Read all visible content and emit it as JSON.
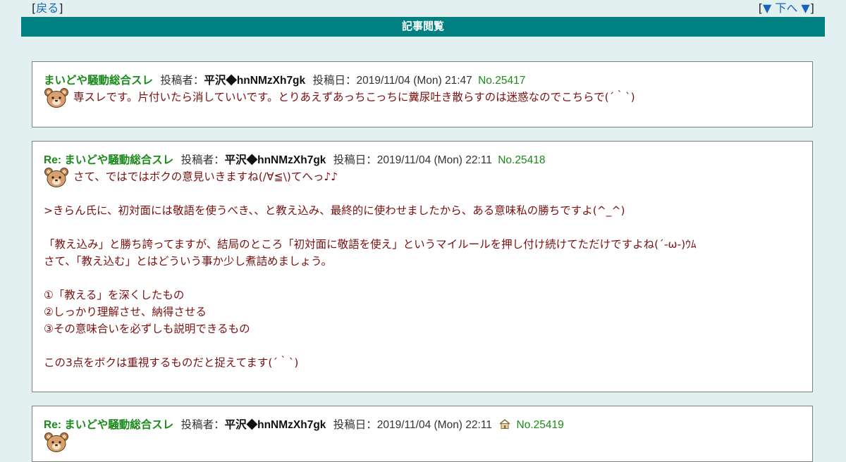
{
  "nav": {
    "back_label": "戻る",
    "down_label": "▼ 下へ ▼"
  },
  "title": "記事閲覧",
  "posts": [
    {
      "subject": "まいどや騒動総合スレ",
      "author_label": "投稿者：",
      "author": "平沢◆hnNMzXh7gk",
      "date_label": "投稿日：",
      "date": "2019/11/04 (Mon) 21:47",
      "no": "No.25417",
      "lines": [
        "専スレです。片付いたら消していいです。とりあえずあっちこっちに糞尿吐き散らすのは迷惑なのでこちらで(´｀`)"
      ]
    },
    {
      "subject": "Re: まいどや騒動総合スレ",
      "author_label": "投稿者：",
      "author": "平沢◆hnNMzXh7gk",
      "date_label": "投稿日：",
      "date": "2019/11/04 (Mon) 22:11",
      "no": "No.25418",
      "lines": [
        "さて、ではではボクの意見いきますね(/∀≦\\)てへっ♪♪",
        "",
        ">きらん氏に、初対面には敬語を使うべき、、と教え込み、最終的に使わせましたから、ある意味私の勝ちですよ(^_^)",
        "",
        "「教え込み」と勝ち誇ってますが、結局のところ「初対面に敬語を使え」というマイルールを押し付け続けてただけですよね(´-ω-)ｳﾑ",
        "さて、「教え込む」とはどういう事か少し煮詰めましょう。",
        "",
        "①「教える」を深くしたもの",
        "②しっかり理解させ、納得させる",
        "③その意味合いを必ずしも説明できるもの",
        "",
        "この3点をボクは重視するものだと捉えてます(´｀`)"
      ]
    },
    {
      "subject": "Re: まいどや騒動総合スレ",
      "author_label": "投稿者：",
      "author": "平沢◆hnNMzXh7gk",
      "date_label": "投稿日：",
      "date": "2019/11/04 (Mon) 22:11",
      "no": "No.25419",
      "lines": [
        ""
      ]
    }
  ]
}
